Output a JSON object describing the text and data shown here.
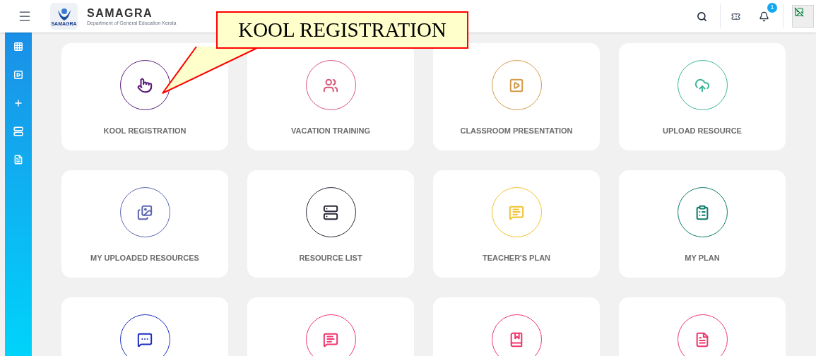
{
  "header": {
    "logo_caption": "SAMAGRA",
    "title": "SAMAGRA",
    "subtitle": "Department of General Education Kerala",
    "notification_count": "1"
  },
  "sidebar": {
    "items": [
      {
        "kind": "grid"
      },
      {
        "kind": "play"
      },
      {
        "kind": "plus"
      },
      {
        "kind": "server"
      },
      {
        "kind": "file"
      }
    ]
  },
  "callout": {
    "text": "KOOL REGISTRATION"
  },
  "tiles": [
    {
      "label": "KOOL REGISTRATION",
      "kind": "pointer",
      "color": "#5b1a7a"
    },
    {
      "label": "VACATION TRAINING",
      "kind": "users",
      "color": "#d9577a"
    },
    {
      "label": "CLASSROOM PRESENTATION",
      "kind": "play",
      "color": "#d39a4a"
    },
    {
      "label": "UPLOAD RESOURCE",
      "kind": "cloud",
      "color": "#3fb59b"
    },
    {
      "label": "MY UPLOADED RESOURCES",
      "kind": "images",
      "color": "#5c67b0"
    },
    {
      "label": "RESOURCE LIST",
      "kind": "server",
      "color": "#2b2838"
    },
    {
      "label": "TEACHER'S PLAN",
      "kind": "note",
      "color": "#f2c230"
    },
    {
      "label": "MY PLAN",
      "kind": "clipboard",
      "color": "#0e7c6b"
    },
    {
      "kind": "chat",
      "color": "#1a2fc2"
    },
    {
      "kind": "note",
      "color": "#f0356d"
    },
    {
      "kind": "book",
      "color": "#f0356d"
    },
    {
      "kind": "file",
      "color": "#f0356d"
    }
  ]
}
